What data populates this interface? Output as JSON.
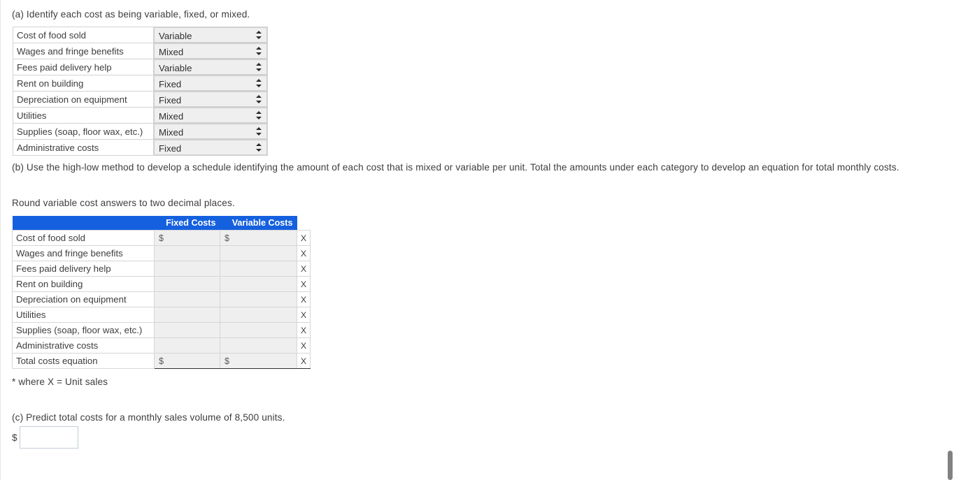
{
  "part_a": {
    "prompt": "(a) Identify each cost as being variable, fixed, or mixed.",
    "rows": [
      {
        "label": "Cost of food sold",
        "selected": "Variable"
      },
      {
        "label": "Wages and fringe benefits",
        "selected": "Mixed"
      },
      {
        "label": "Fees paid delivery help",
        "selected": "Variable"
      },
      {
        "label": "Rent on building",
        "selected": "Fixed"
      },
      {
        "label": "Depreciation on equipment",
        "selected": "Fixed"
      },
      {
        "label": "Utilities",
        "selected": "Mixed"
      },
      {
        "label": "Supplies (soap, floor wax, etc.)",
        "selected": "Mixed"
      },
      {
        "label": "Administrative costs",
        "selected": "Fixed"
      }
    ]
  },
  "part_b": {
    "prompt": "(b) Use the high-low method to develop a schedule identifying the amount of each cost that is mixed or variable per unit. Total the amounts under each category to develop an equation for total monthly costs.",
    "round_note": "Round variable cost answers to two decimal places.",
    "footnote": "* where X = Unit sales",
    "header_accent": "#1560de",
    "columns": {
      "blank": "",
      "fixed": "Fixed Costs",
      "variable": "Variable Costs",
      "unit": ""
    },
    "rows": [
      {
        "label": "Cost of food sold",
        "fixed": "$",
        "variable": "$",
        "unit": "X"
      },
      {
        "label": "Wages and fringe benefits",
        "fixed": "",
        "variable": "",
        "unit": "X"
      },
      {
        "label": "Fees paid delivery help",
        "fixed": "",
        "variable": "",
        "unit": "X"
      },
      {
        "label": "Rent on building",
        "fixed": "",
        "variable": "",
        "unit": "X"
      },
      {
        "label": "Depreciation on equipment",
        "fixed": "",
        "variable": "",
        "unit": "X"
      },
      {
        "label": "Utilities",
        "fixed": "",
        "variable": "",
        "unit": "X"
      },
      {
        "label": "Supplies (soap, floor wax, etc.)",
        "fixed": "",
        "variable": "",
        "unit": "X"
      },
      {
        "label": "Administrative costs",
        "fixed": "",
        "variable": "",
        "unit": "X"
      }
    ],
    "total_row": {
      "label": "Total costs equation",
      "fixed": "$",
      "variable": "$",
      "unit": "X"
    }
  },
  "part_c": {
    "prompt": "(c) Predict total costs for a monthly sales volume of 8,500 units.",
    "dollar_sign": "$",
    "input_value": "",
    "input_placeholder": ""
  }
}
